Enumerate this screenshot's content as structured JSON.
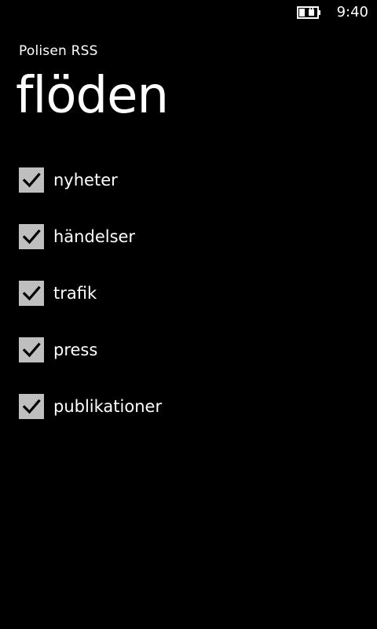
{
  "status_bar": {
    "time": "9:40",
    "battery_icon": "battery-charging-icon"
  },
  "app": {
    "title": "Polisen RSS"
  },
  "page": {
    "title": "flöden"
  },
  "feeds": [
    {
      "label": "nyheter",
      "checked": true
    },
    {
      "label": "händelser",
      "checked": true
    },
    {
      "label": "trafik",
      "checked": true
    },
    {
      "label": "press",
      "checked": true
    },
    {
      "label": "publikationer",
      "checked": true
    }
  ],
  "colors": {
    "background": "#000000",
    "text": "#ffffff",
    "checkbox_fill": "#bfbfbf",
    "checkmark": "#000000"
  }
}
